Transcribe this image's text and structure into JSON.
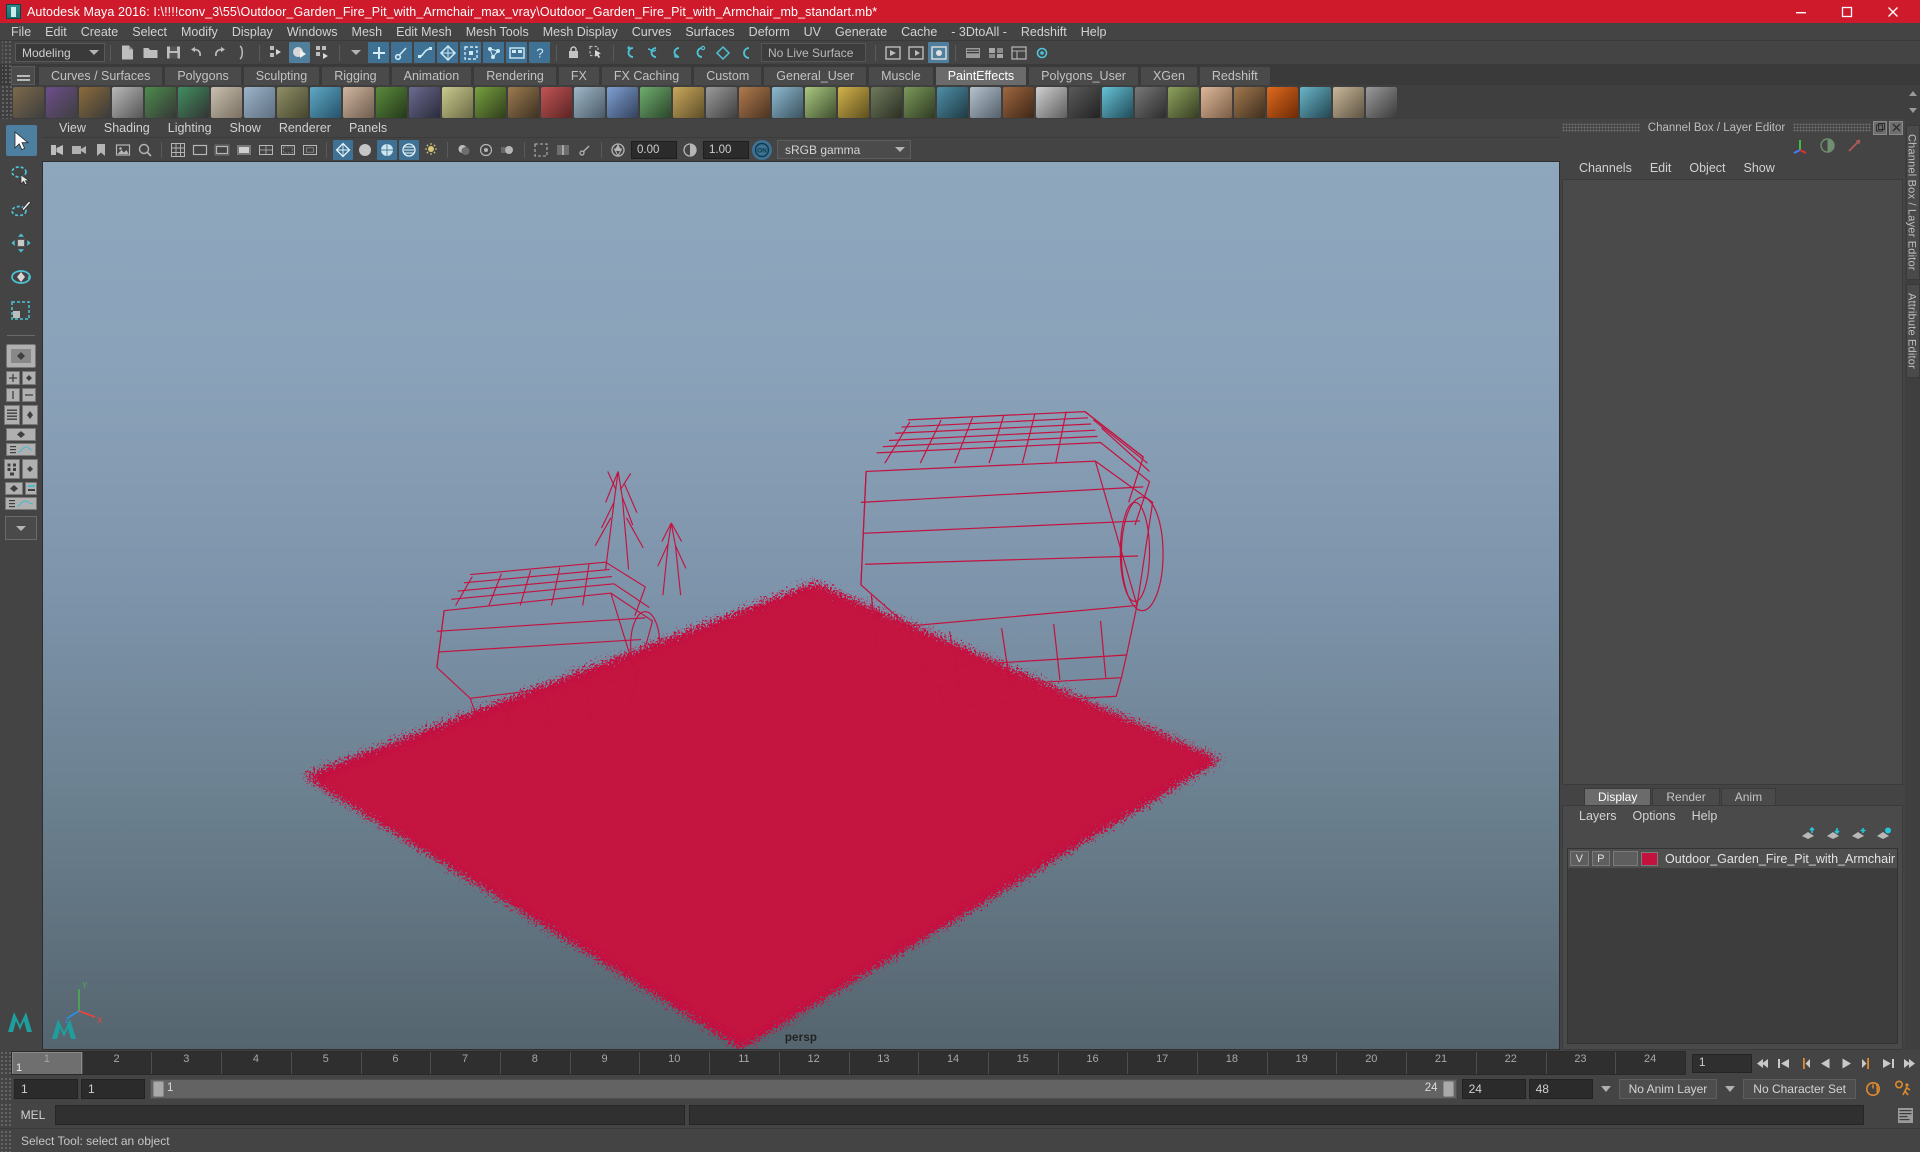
{
  "window": {
    "title": "Autodesk Maya 2016: I:\\!!!!conv_3\\55\\Outdoor_Garden_Fire_Pit_with_Armchair_max_vray\\Outdoor_Garden_Fire_Pit_with_Armchair_mb_standart.mb*",
    "minimize": "minimize-icon",
    "maximize": "maximize-icon",
    "close": "close-icon",
    "titlebar_color": "#cf1a2b"
  },
  "menubar": {
    "items": [
      "File",
      "Edit",
      "Create",
      "Select",
      "Modify",
      "Display",
      "Windows",
      "Mesh",
      "Edit Mesh",
      "Mesh Tools",
      "Mesh Display",
      "Curves",
      "Surfaces",
      "Deform",
      "UV",
      "Generate",
      "Cache",
      "- 3DtoAll -",
      "Redshift",
      "Help"
    ]
  },
  "statusline": {
    "mode": "Modeling",
    "live_surface": "No Live Surface"
  },
  "shelf": {
    "tabs": [
      "Curves / Surfaces",
      "Polygons",
      "Sculpting",
      "Rigging",
      "Animation",
      "Rendering",
      "FX",
      "FX Caching",
      "Custom",
      "General_User",
      "Muscle",
      "PaintEffects",
      "Polygons_User",
      "XGen",
      "Redshift"
    ],
    "active_tab": "PaintEffects"
  },
  "viewport": {
    "menu": [
      "View",
      "Shading",
      "Lighting",
      "Show",
      "Renderer",
      "Panels"
    ],
    "exposure": "0.00",
    "gamma": "1.00",
    "color_management": "sRGB gamma",
    "camera_label": "persp"
  },
  "channel_box": {
    "title": "Channel Box / Layer Editor",
    "menu": [
      "Channels",
      "Edit",
      "Object",
      "Show"
    ]
  },
  "layer_editor": {
    "tabs": [
      "Display",
      "Render",
      "Anim"
    ],
    "active_tab": "Display",
    "menu": [
      "Layers",
      "Options",
      "Help"
    ],
    "rows": [
      {
        "visibility": "V",
        "playback": "P",
        "shading": "",
        "color": "#c4123f",
        "name": "Outdoor_Garden_Fire_Pit_with_Armchair"
      }
    ]
  },
  "right_vtabs": [
    "Channel Box / Layer Editor",
    "Attribute Editor"
  ],
  "timeline": {
    "ticks": [
      1,
      2,
      3,
      4,
      5,
      6,
      7,
      8,
      9,
      10,
      11,
      12,
      13,
      14,
      15,
      16,
      17,
      18,
      19,
      20,
      21,
      22,
      23,
      24
    ],
    "current_frame": "1",
    "current_frame_field": "1"
  },
  "range": {
    "start": "1",
    "anim_start": "1",
    "bar_start_label": "1",
    "bar_end_label": "24",
    "anim_end": "24",
    "end": "48",
    "anim_layer": "No Anim Layer",
    "character_set": "No Character Set"
  },
  "command_line": {
    "language": "MEL",
    "input": ""
  },
  "status_bar": {
    "message": "Select Tool: select an object"
  }
}
